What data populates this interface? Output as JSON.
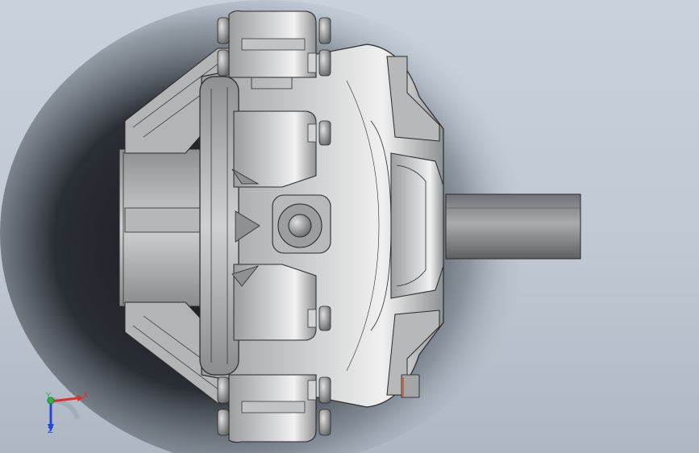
{
  "viewport": {
    "background_top": "#c9d2dc",
    "background_bottom": "#aeb8c4",
    "shadow_color": "#1a1d22",
    "model_metal_color": "#a7a8ab",
    "edge_color": "#2a2a2a"
  },
  "triad": {
    "x_label": "X",
    "y_label": "Y",
    "z_label": "Z",
    "x_color": "#e0302a",
    "y_color": "#2fb34a",
    "z_color": "#2346d8"
  }
}
